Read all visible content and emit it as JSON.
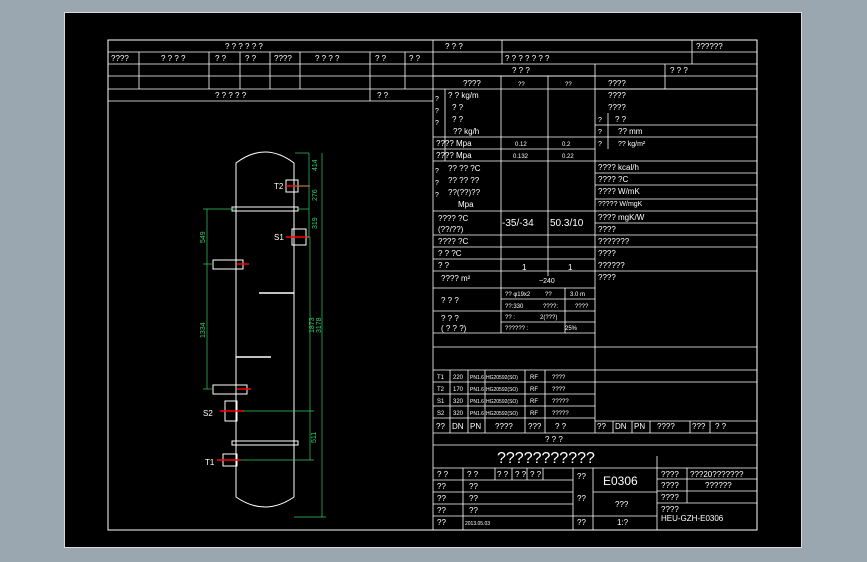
{
  "header": {
    "row1_left": "? ? ? ? ? ?",
    "row1_mid": "? ? ?",
    "row1_right": "??????",
    "row2_cells": [
      "????",
      "? ? ? ?",
      "? ?",
      "? ?",
      "????",
      "? ? ? ?",
      "? ?",
      "? ?"
    ],
    "row2_right": "? ? ? ? ? ? ?",
    "row3_right_a": "? ? ?",
    "row3_right_b": "? ? ?",
    "row5_left": "? ? ? ? ?",
    "row5_mid": "? ?"
  },
  "spec_left": [
    {
      "label": "????",
      "v1": "??",
      "v2": "??"
    },
    {
      "label": "? ?  kg/m",
      "v1": "",
      "v2": ""
    },
    {
      "label": "? ?",
      "v1": "",
      "v2": ""
    },
    {
      "label": "? ?",
      "v1": "",
      "v2": ""
    },
    {
      "label": "?? kg/h",
      "v1": "",
      "v2": ""
    },
    {
      "label": "???? Mpa",
      "v1": "0.12",
      "v2": "0.2"
    },
    {
      "label": "???? Mpa",
      "v1": "0.132",
      "v2": "0.22"
    },
    {
      "label": "?? ?? ?C",
      "v1": "",
      "v2": ""
    },
    {
      "label": "?? ?? ??",
      "v1": "",
      "v2": ""
    },
    {
      "label": "??(??)??",
      "v1": "",
      "v2": ""
    },
    {
      "label": "Mpa",
      "v1": "",
      "v2": ""
    },
    {
      "label": "???? ?C",
      "v1": "-35/-34",
      "v2": "50.3/10"
    },
    {
      "label": "(??/??)",
      "v1": "",
      "v2": ""
    },
    {
      "label": "???? ?C",
      "v1": "",
      "v2": ""
    },
    {
      "label": "? ? ?C",
      "v1": "",
      "v2": ""
    },
    {
      "label": "? ?",
      "v1": "1",
      "v2": "1"
    },
    {
      "label": "???? m²",
      "v1": "~240",
      "v2": ""
    }
  ],
  "spec_sub": {
    "r1a": "?? φ19x2",
    "r1b": "??",
    "r1c": "3.0 m",
    "r2a": "??:330",
    "r2b": "????:",
    "r2c": "????",
    "r3a": "?? :",
    "r3b": "2(???)",
    "r4a": "?????? :",
    "r4b": "25%",
    "sub_label_1": "? ? ?",
    "sub_label_2": "? ? ?",
    "sub_label_3": "( ? ? ?)"
  },
  "spec_right": [
    "????",
    "????",
    "????",
    "? ?",
    "?? mm",
    "?? kg/m²",
    "???? kcal/h",
    "???? ?C",
    "???? W/mK",
    "????? W/mgK",
    "???? mgK/W",
    "????",
    "???????",
    "????",
    "??????",
    "????"
  ],
  "nozzles": {
    "headers": [
      "??",
      "DN",
      "PN",
      "????",
      "???",
      "? ?"
    ],
    "rows": [
      {
        "id": "T1",
        "dn": "220",
        "pn": "PN1.6",
        "std": "HG20592(SO)",
        "face": "RF",
        "use": "????"
      },
      {
        "id": "T2",
        "dn": "170",
        "pn": "PN1.6",
        "std": "HG20592(SO)",
        "face": "RF",
        "use": "????"
      },
      {
        "id": "S1",
        "dn": "320",
        "pn": "PN1.6",
        "std": "HG20592(SO)",
        "face": "RF",
        "use": "?????"
      },
      {
        "id": "S2",
        "dn": "320",
        "pn": "PN1.6",
        "std": "HG20592(SO)",
        "face": "RF",
        "use": "?????"
      }
    ],
    "title": "? ? ?"
  },
  "titleblock": {
    "big_title": "???????????",
    "drawing_no": "E0306",
    "top_a": "????",
    "top_b": "???20???????",
    "mid_a": "????",
    "mid_b": "??????",
    "mid_c": "????",
    "low_a": "????",
    "code": "HEU-GZH-E0306",
    "sig_rows": [
      {
        "a": "??",
        "b": "??"
      },
      {
        "a": "??",
        "b": "??"
      },
      {
        "a": "??",
        "b": "??"
      },
      {
        "a": "??",
        "b": "2013.05.03"
      }
    ],
    "rt1": "??",
    "rt2": "??",
    "rt3": "??",
    "scale_label": "???",
    "scale_val": "1:?",
    "head_cells": [
      "? ?",
      "? ?",
      "? ?",
      "? ?",
      "? ?"
    ]
  },
  "drawing": {
    "labels": {
      "T2": "T2",
      "S1": "S1",
      "S2": "S2",
      "T1": "T1"
    },
    "dims": {
      "d414": "414",
      "d276": "276",
      "d319": "319",
      "d549": "549",
      "d1334": "1334",
      "d1873": "1873",
      "d3178": "3178",
      "d511": "511"
    }
  }
}
